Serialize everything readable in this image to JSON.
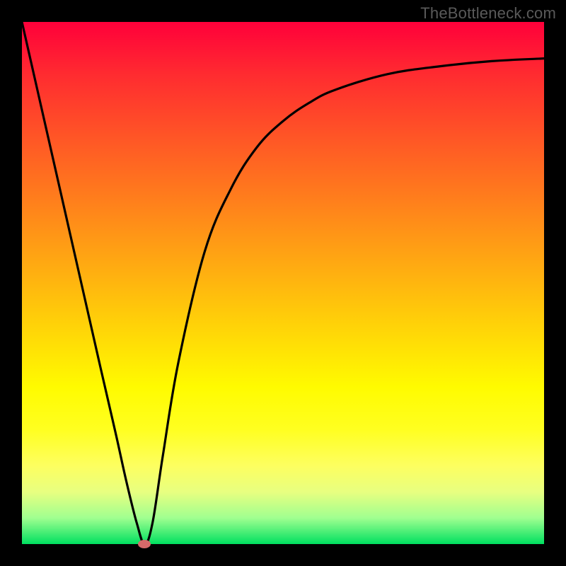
{
  "watermark": "TheBottleneck.com",
  "chart_data": {
    "type": "line",
    "title": "",
    "xlabel": "",
    "ylabel": "",
    "xlim": [
      0,
      100
    ],
    "ylim": [
      0,
      100
    ],
    "series": [
      {
        "name": "curve",
        "x": [
          0,
          5,
          10,
          15,
          18,
          20,
          22,
          23.5,
          25,
          27,
          30,
          35,
          40,
          45,
          50,
          55,
          60,
          70,
          80,
          90,
          100
        ],
        "values": [
          100,
          78,
          56,
          34,
          21,
          12,
          4,
          0,
          4,
          17,
          35,
          56,
          68,
          76,
          81,
          84.5,
          87,
          90,
          91.5,
          92.5,
          93
        ]
      }
    ],
    "marker": {
      "x": 23.5,
      "y": 0
    },
    "colors": {
      "top": "#ff003a",
      "bottom": "#00e060",
      "curve": "#000000",
      "marker": "#d66a6a",
      "watermark": "#5a5a5a"
    }
  }
}
